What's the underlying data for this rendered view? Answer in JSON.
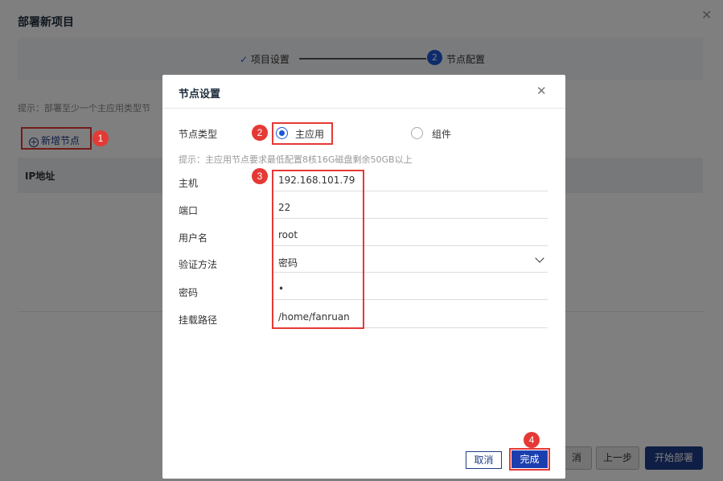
{
  "background": {
    "title": "部署新项目",
    "steps": [
      {
        "label": "项目设置",
        "check": "✓"
      },
      {
        "label": "节点配置",
        "number": "2"
      }
    ],
    "hint": "提示：部署至少一个主应用类型节",
    "add_node_label": "新增节点",
    "table_header": "IP地址",
    "buttons": {
      "cancel": "消",
      "prev": "上一步",
      "start": "开始部署"
    }
  },
  "modal": {
    "title": "节点设置",
    "node_type_label": "节点类型",
    "radio_main": "主应用",
    "radio_component": "组件",
    "hint": "提示：主应用节点要求最低配置8核16G磁盘剩余50GB以上",
    "fields": [
      {
        "label": "主机",
        "value": "192.168.101.79"
      },
      {
        "label": "端口",
        "value": "22"
      },
      {
        "label": "用户名",
        "value": "root"
      },
      {
        "label": "验证方法",
        "value": "密码"
      },
      {
        "label": "密码",
        "value": "•"
      },
      {
        "label": "挂载路径",
        "value": "/home/fanruan"
      }
    ],
    "cancel_label": "取消",
    "done_label": "完成"
  },
  "badges": [
    "1",
    "2",
    "3",
    "4"
  ],
  "colors": {
    "accent": "#1c56d7",
    "highlight": "#e53935",
    "primary_button": "#1f3c88"
  }
}
